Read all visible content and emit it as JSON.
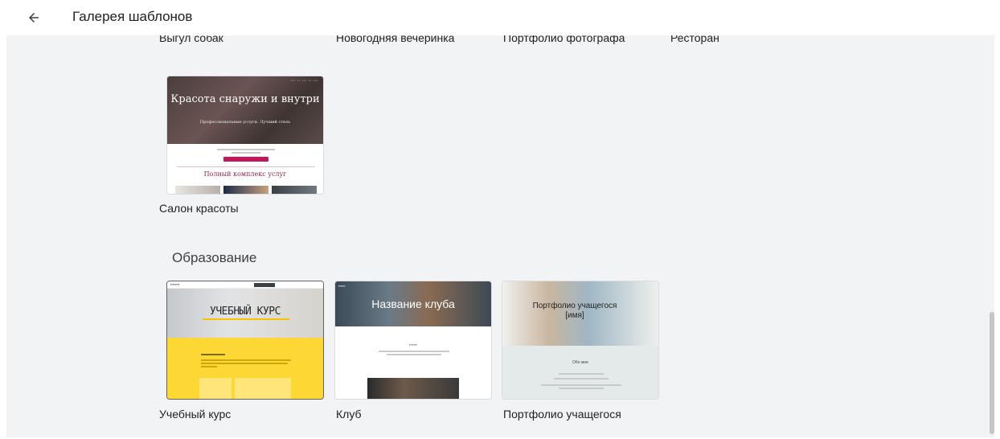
{
  "header": {
    "title": "Галерея шаблонов"
  },
  "top_row_labels": [
    "Выгул собак",
    "Новогодняя вечеринка",
    "Портфолио фотографа",
    "Ресторан"
  ],
  "salon": {
    "label": "Салон красоты",
    "hero_title": "Красота снаружи и внутри",
    "hero_subtitle": "Профессиональные услуги. Лучший стиль",
    "services": "Полный комплекс услуг"
  },
  "education": {
    "section_title": "Образование",
    "course": {
      "label": "Учебный курс",
      "hero_title": "УЧЕБНЫЙ КУРС"
    },
    "club": {
      "label": "Клуб",
      "hero_title": "Название клуба"
    },
    "portfolio": {
      "label": "Портфолио учащегося",
      "hero_title": "Портфолио учащегося [имя]",
      "about": "Обо мне"
    }
  }
}
